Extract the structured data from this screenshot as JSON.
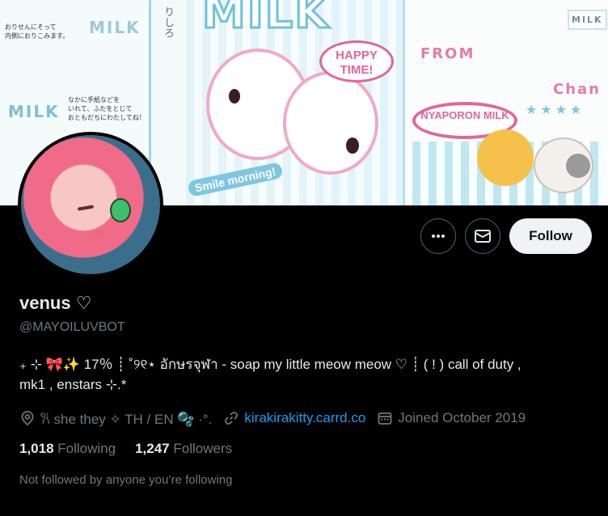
{
  "banner": {
    "title_text": "MILK",
    "speech_bubble": "HAPPY TIME!",
    "from_text": "FROM",
    "chan_text": "Chan",
    "carton_text": "NYAPORON MILK",
    "carton_top": "MILK",
    "smile_text": "Smile morning!",
    "left_milk": "MILK",
    "jp_text_1": "おりせんにそって\n内側におりこみます。",
    "jp_text_2": "なかに手紙などを\nいれて、ふたをとじて\nおともだちにわたしてね！",
    "jp_side": "りしろ",
    "colors": {
      "accent_pink": "#e2659c",
      "accent_blue": "#7fc6e0"
    }
  },
  "actions": {
    "more_icon": "more-dots-icon",
    "message_icon": "envelope-icon",
    "follow_label": "Follow"
  },
  "profile": {
    "display_name": "venus ♡",
    "handle": "@MAYOILUVBOT",
    "bio_line1": "₊ ⊹ 🎀✨ 17％ ┊ ˚୨୧⋆ อักษรจุฬา - soap my little meow meow ♡ ┊ ( ! ) call of duty ,",
    "bio_line2": "mk1 , enstars ⊹.*",
    "location": "𐙚 she they ✧ TH / EN 🫧 ·°.",
    "link": "kirakirakitty.carrd.co",
    "joined": "Joined October 2019"
  },
  "stats": {
    "following_count": "1,018",
    "following_label": "Following",
    "followers_count": "1,247",
    "followers_label": "Followers"
  },
  "social_context": "Not followed by anyone you’re following"
}
